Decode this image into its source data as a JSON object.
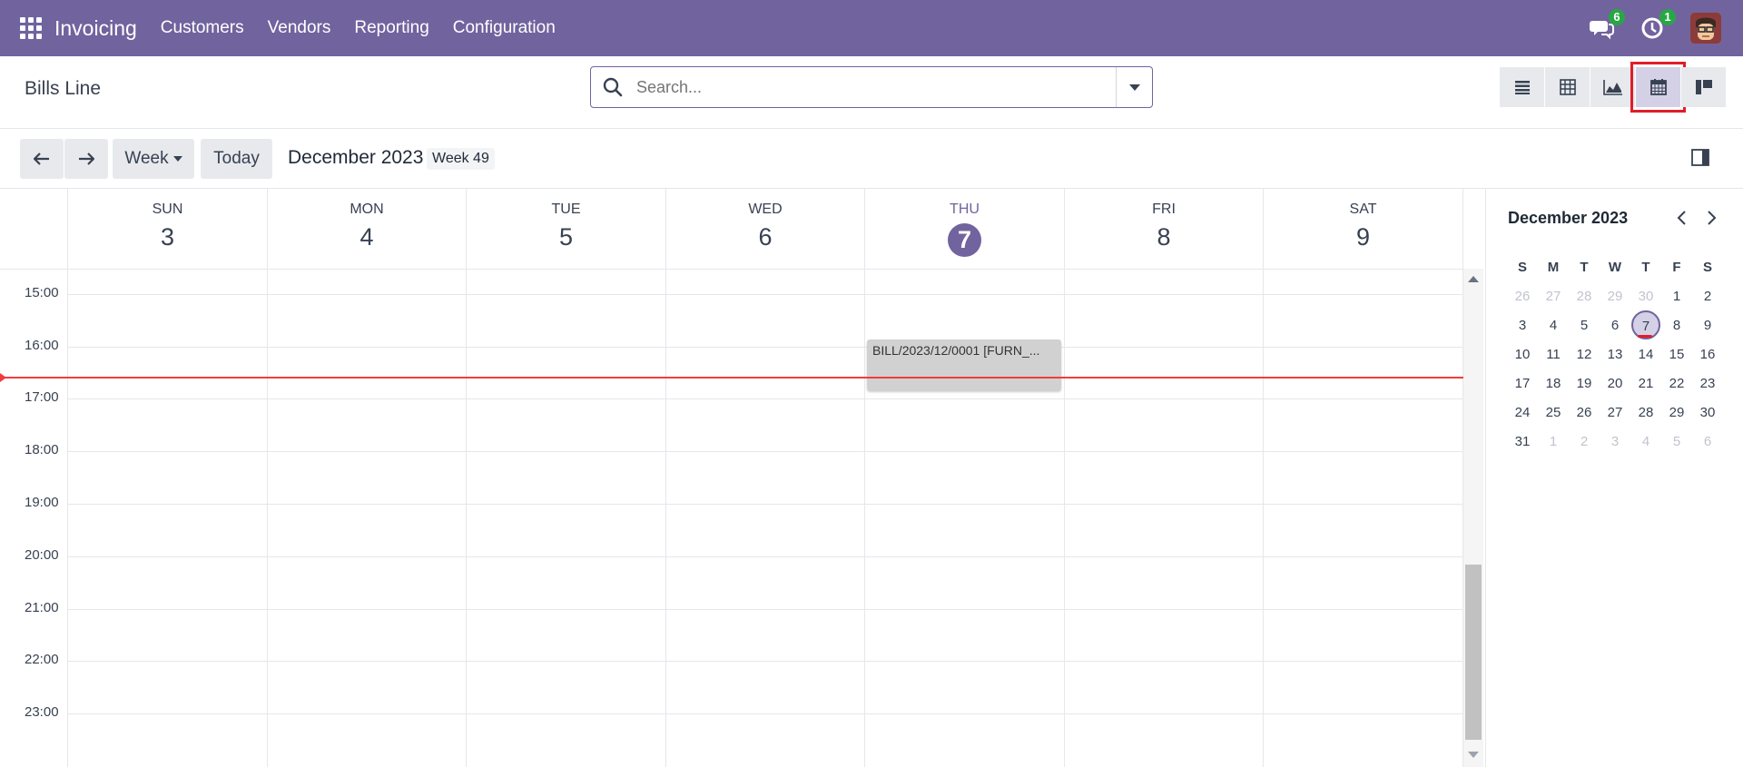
{
  "navbar": {
    "app_name": "Invoicing",
    "menu": [
      "Customers",
      "Vendors",
      "Reporting",
      "Configuration"
    ],
    "messages_count": "6",
    "activities_count": "1"
  },
  "control": {
    "page_title": "Bills Line",
    "search_placeholder": "Search...",
    "views": [
      "list",
      "pivot",
      "graph",
      "calendar",
      "kanban"
    ],
    "active_view": "calendar"
  },
  "toolbar": {
    "scale_label": "Week",
    "today_label": "Today",
    "title": "December 2023",
    "week_label": "Week 49"
  },
  "days": [
    {
      "name": "SUN",
      "num": "3"
    },
    {
      "name": "MON",
      "num": "4"
    },
    {
      "name": "TUE",
      "num": "5"
    },
    {
      "name": "WED",
      "num": "6"
    },
    {
      "name": "THU",
      "num": "7",
      "today": true
    },
    {
      "name": "FRI",
      "num": "8"
    },
    {
      "name": "SAT",
      "num": "9"
    }
  ],
  "hours": [
    "15:00",
    "16:00",
    "17:00",
    "18:00",
    "19:00",
    "20:00",
    "21:00",
    "22:00",
    "23:00"
  ],
  "event": {
    "label": "BILL/2023/12/0001 [FURN_..."
  },
  "mini_calendar": {
    "title": "December 2023",
    "weekdays": [
      "S",
      "M",
      "T",
      "W",
      "T",
      "F",
      "S"
    ],
    "weeks": [
      [
        "26",
        "27",
        "28",
        "29",
        "30",
        "1",
        "2"
      ],
      [
        "3",
        "4",
        "5",
        "6",
        "7",
        "8",
        "9"
      ],
      [
        "10",
        "11",
        "12",
        "13",
        "14",
        "15",
        "16"
      ],
      [
        "17",
        "18",
        "19",
        "20",
        "21",
        "22",
        "23"
      ],
      [
        "24",
        "25",
        "26",
        "27",
        "28",
        "29",
        "30"
      ],
      [
        "31",
        "1",
        "2",
        "3",
        "4",
        "5",
        "6"
      ]
    ],
    "selected": "7"
  },
  "colors": {
    "brand": "#71639e",
    "now_line": "#f23c3c",
    "badge": "#28a745"
  }
}
